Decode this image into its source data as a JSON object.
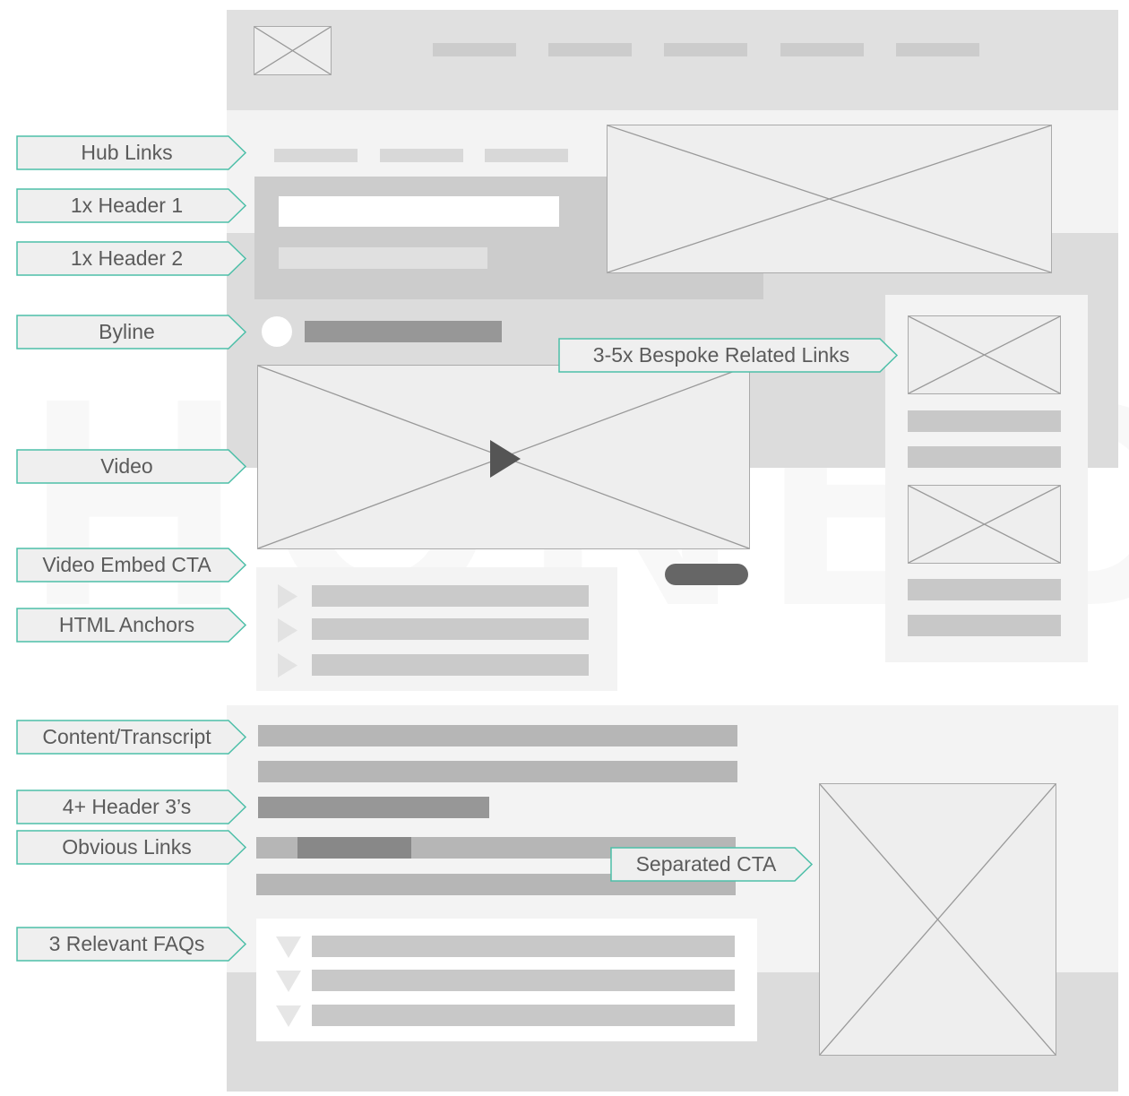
{
  "watermark": "HONED",
  "colors": {
    "accent_teal": "#4dbfa8",
    "label_fill": "#efefef",
    "label_text": "#5b5b5b",
    "header_band": "#e0e0e0",
    "light_band": "#f3f3f3",
    "mid_band": "#dcdcdc",
    "placeholder_bar": "#c8c8c8",
    "dark_bar": "#979797",
    "cta_button": "#666666"
  },
  "annotations": [
    {
      "id": "hub-links",
      "label": "Hub Links"
    },
    {
      "id": "header-1",
      "label": "1x Header 1"
    },
    {
      "id": "header-2",
      "label": "1x Header 2"
    },
    {
      "id": "byline",
      "label": "Byline"
    },
    {
      "id": "video",
      "label": "Video"
    },
    {
      "id": "video-embed-cta",
      "label": "Video Embed CTA"
    },
    {
      "id": "html-anchors",
      "label": "HTML Anchors"
    },
    {
      "id": "content-transcript",
      "label": "Content/Transcript"
    },
    {
      "id": "header-3s",
      "label": "4+ Header 3’s"
    },
    {
      "id": "obvious-links",
      "label": "Obvious Links"
    },
    {
      "id": "relevant-faqs",
      "label": "3 Relevant FAQs"
    },
    {
      "id": "related-links",
      "label": "3-5x Bespoke Related Links"
    },
    {
      "id": "separated-cta",
      "label": "Separated CTA"
    }
  ],
  "wireframe": {
    "nav_item_count": 5,
    "hub_link_count": 3,
    "anchor_item_count": 3,
    "faq_item_count": 3,
    "related_link_cards": 2
  }
}
